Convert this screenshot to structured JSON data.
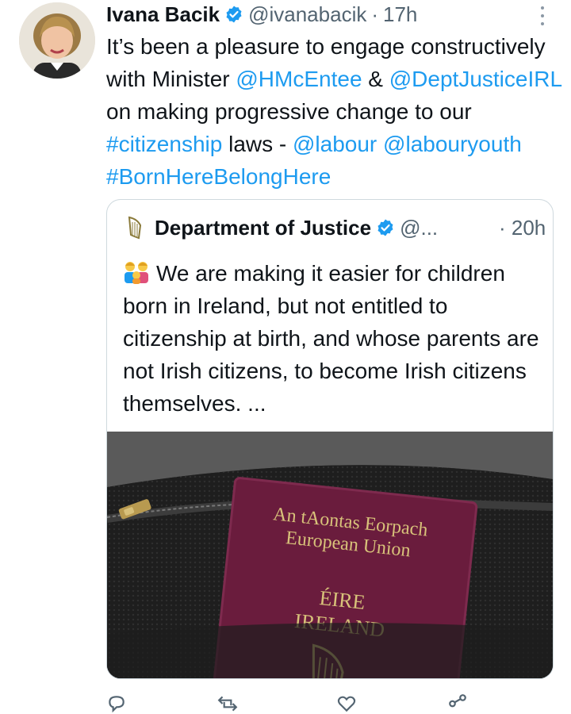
{
  "tweet": {
    "author_name": "Ivana Bacik",
    "handle": "@ivanabacik",
    "separator": "·",
    "time": "17h",
    "text_segments": [
      {
        "text": "It’s been a pleasure to engage constructively with Minister ",
        "link": false
      },
      {
        "text": "@HMcEntee",
        "link": true
      },
      {
        "text": " & ",
        "link": false
      },
      {
        "text": "@DeptJusticeIRL",
        "link": true
      },
      {
        "text": " on making progressive change to our  ",
        "link": false
      },
      {
        "text": "#citizenship",
        "link": true
      },
      {
        "text": " laws - ",
        "link": false
      },
      {
        "text": "@labour",
        "link": true
      },
      {
        "text": " ",
        "link": false
      },
      {
        "text": "@labouryouth",
        "link": true
      },
      {
        "text": " ",
        "link": false
      },
      {
        "text": "#BornHereBelongHere",
        "link": true
      }
    ],
    "colors": {
      "link": "#1d9bf0",
      "muted": "#536471",
      "verified": "#1d9bf0"
    }
  },
  "quote": {
    "author_name": "Department of Justice",
    "handle": "@...",
    "time": "· 20h",
    "text": "We are making it easier for children born in Ireland, but not entitled to citizenship at birth, and whose parents are not Irish citizens, to become Irish citizens themselves. ...",
    "emoji_icon": "family-emoji-icon",
    "image": {
      "passport_line1": "An tAontas Eorpach",
      "passport_line2": "European Union",
      "passport_line3": "ÉIRE",
      "passport_line4": "IRELAND"
    }
  },
  "actions": {
    "reply_icon": "reply-icon",
    "retweet_icon": "retweet-icon",
    "like_icon": "heart-icon",
    "share_icon": "share-icon"
  }
}
